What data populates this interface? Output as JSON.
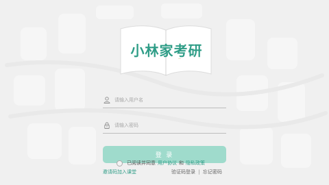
{
  "app": {
    "logo_text": "小林家考研",
    "logo_subtitle": "—"
  },
  "form": {
    "username_placeholder": "请输入用户名",
    "password_placeholder": "请输入密码",
    "login_label": "登 录"
  },
  "agreement": {
    "prefix": "已阅读并同意",
    "user_agreement": "用户协议",
    "joiner": "和",
    "privacy_policy": "隐私政策"
  },
  "footer": {
    "join_class": "邀请码加入课堂",
    "sms_login": "验证码登录",
    "divider": "|",
    "forgot_password": "忘记密码"
  },
  "colors": {
    "accent": "#2f9d87",
    "button": "#9fdbcc",
    "background": "#f0f0f0"
  }
}
